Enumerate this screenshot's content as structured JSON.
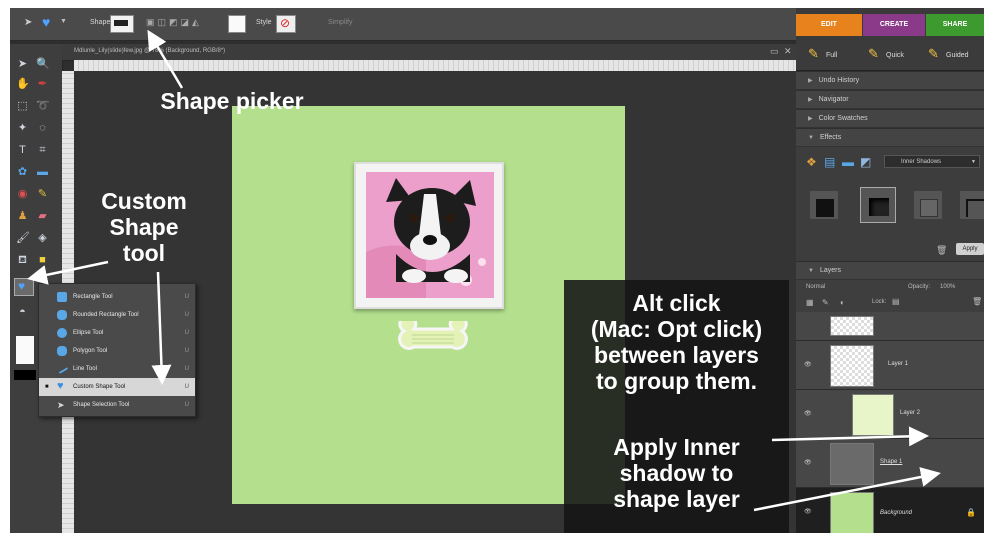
{
  "options_bar": {
    "shape_label": "Shape",
    "style_label": "Style",
    "simplify_label": "Simplify"
  },
  "mode_tabs": [
    {
      "label": "EDIT",
      "color": "#e8821c"
    },
    {
      "label": "CREATE",
      "color": "#8b3a8a"
    },
    {
      "label": "SHARE",
      "color": "#3c9a2e"
    }
  ],
  "edit_subtabs": [
    "Full",
    "Quick",
    "Guided"
  ],
  "document": {
    "title": "Mdlunle_Lily(slide)few.jpg @ 78% (Background, RGB/8*)"
  },
  "panels": {
    "undo_history": "Undo History",
    "navigator": "Navigator",
    "color_swatches": "Color Swatches",
    "effects": "Effects",
    "effects_dropdown": "Inner Shadows",
    "apply_button": "Apply",
    "layers": "Layers",
    "blend_mode": "Normal",
    "opacity_label": "Opacity:",
    "opacity_value": "100%",
    "lock_label": "Lock:"
  },
  "layers": [
    {
      "name": "Layer 1"
    },
    {
      "name": "Layer 2"
    },
    {
      "name": "Shape 1"
    },
    {
      "name": "Background"
    }
  ],
  "shape_flyout": [
    {
      "label": "Rectangle Tool",
      "selected": false
    },
    {
      "label": "Rounded Rectangle Tool",
      "selected": false
    },
    {
      "label": "Ellipse Tool",
      "selected": false
    },
    {
      "label": "Polygon Tool",
      "selected": false
    },
    {
      "label": "Line Tool",
      "selected": false
    },
    {
      "label": "Custom Shape Tool",
      "selected": true
    },
    {
      "label": "Shape Selection Tool",
      "selected": false
    }
  ],
  "callouts": {
    "shape_picker": "Shape picker",
    "custom_shape_line1": "Custom",
    "custom_shape_line2": "Shape",
    "custom_shape_line3": "tool",
    "alt_click_line1": "Alt click",
    "alt_click_line2": "(Mac: Opt click)",
    "alt_click_line3": "between layers",
    "alt_click_line4": "to group them.",
    "inner_shadow_line1": "Apply Inner",
    "inner_shadow_line2": "shadow to",
    "inner_shadow_line3": "shape layer"
  },
  "colors": {
    "paper_green": "#b4e08e",
    "edit_orange": "#e8821c",
    "workspace_dark": "#2e2e2e"
  }
}
